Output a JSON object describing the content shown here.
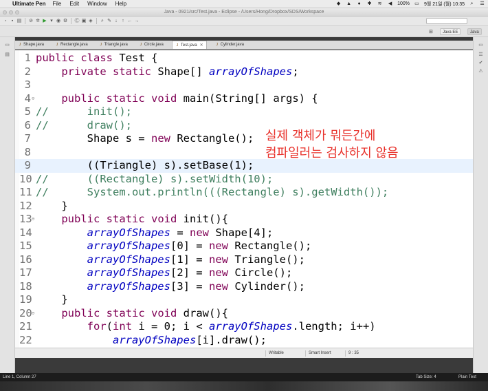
{
  "menubar": {
    "app_name": "Ultimate Pen",
    "items": [
      "File",
      "Edit",
      "Window",
      "Help"
    ],
    "battery": "100%",
    "datetime": "9월 21일 (월)  10:35"
  },
  "window": {
    "title": "Java - 0921/src/Test.java - Eclipse - /Users/Hong/Dropbox/SDS/Workspace"
  },
  "perspectives": {
    "java_ee": "Java EE",
    "java": "Java"
  },
  "tabs": [
    {
      "label": "Shape.java",
      "active": false
    },
    {
      "label": "Rectangle.java",
      "active": false
    },
    {
      "label": "Triangle.java",
      "active": false
    },
    {
      "label": "Circle.java",
      "active": false
    },
    {
      "label": "Test.java",
      "active": true
    },
    {
      "label": "Cylinder.java",
      "active": false
    }
  ],
  "code_lines": [
    {
      "n": "1",
      "fold": "",
      "text": "public class Test {"
    },
    {
      "n": "2",
      "fold": "",
      "text": "    private static Shape[] arrayOfShapes;"
    },
    {
      "n": "3",
      "fold": "",
      "text": ""
    },
    {
      "n": "4",
      "fold": "⊖",
      "text": "    public static void main(String[] args) {"
    },
    {
      "n": "5",
      "fold": "",
      "text": "//      init();"
    },
    {
      "n": "6",
      "fold": "",
      "text": "//      draw();"
    },
    {
      "n": "7",
      "fold": "",
      "text": "        Shape s = new Rectangle();"
    },
    {
      "n": "8",
      "fold": "",
      "text": ""
    },
    {
      "n": "9",
      "fold": "",
      "text": "        ((Triangle) s).setBase(1);"
    },
    {
      "n": "10",
      "fold": "",
      "text": "//      ((Rectangle) s).setWidth(10);"
    },
    {
      "n": "11",
      "fold": "",
      "text": "//      System.out.println(((Rectangle) s).getWidth());"
    },
    {
      "n": "12",
      "fold": "",
      "text": "    }"
    },
    {
      "n": "13",
      "fold": "⊖",
      "text": "    public static void init(){"
    },
    {
      "n": "14",
      "fold": "",
      "text": "        arrayOfShapes = new Shape[4];"
    },
    {
      "n": "15",
      "fold": "",
      "text": "        arrayOfShapes[0] = new Rectangle();"
    },
    {
      "n": "16",
      "fold": "",
      "text": "        arrayOfShapes[1] = new Triangle();"
    },
    {
      "n": "17",
      "fold": "",
      "text": "        arrayOfShapes[2] = new Circle();"
    },
    {
      "n": "18",
      "fold": "",
      "text": "        arrayOfShapes[3] = new Cylinder();"
    },
    {
      "n": "19",
      "fold": "",
      "text": "    }"
    },
    {
      "n": "20",
      "fold": "⊖",
      "text": "    public static void draw(){"
    },
    {
      "n": "21",
      "fold": "",
      "text": "        for(int i = 0; i < arrayOfShapes.length; i++)"
    },
    {
      "n": "22",
      "fold": "",
      "text": "            arrayOfShapes[i].draw();"
    }
  ],
  "current_line": "9",
  "annotation": {
    "line1": "실제 객체가 뭐든간에",
    "line2": "컴파일러는 검사하지 않음",
    "color": "#e8302a"
  },
  "editor_status": {
    "writable": "Writable",
    "insert_mode": "Smart Insert",
    "position": "9 : 35"
  },
  "app_status": {
    "cursor": "Line 1, Column 27",
    "tab_size": "Tab Size: 4",
    "format": "Plain Text"
  }
}
